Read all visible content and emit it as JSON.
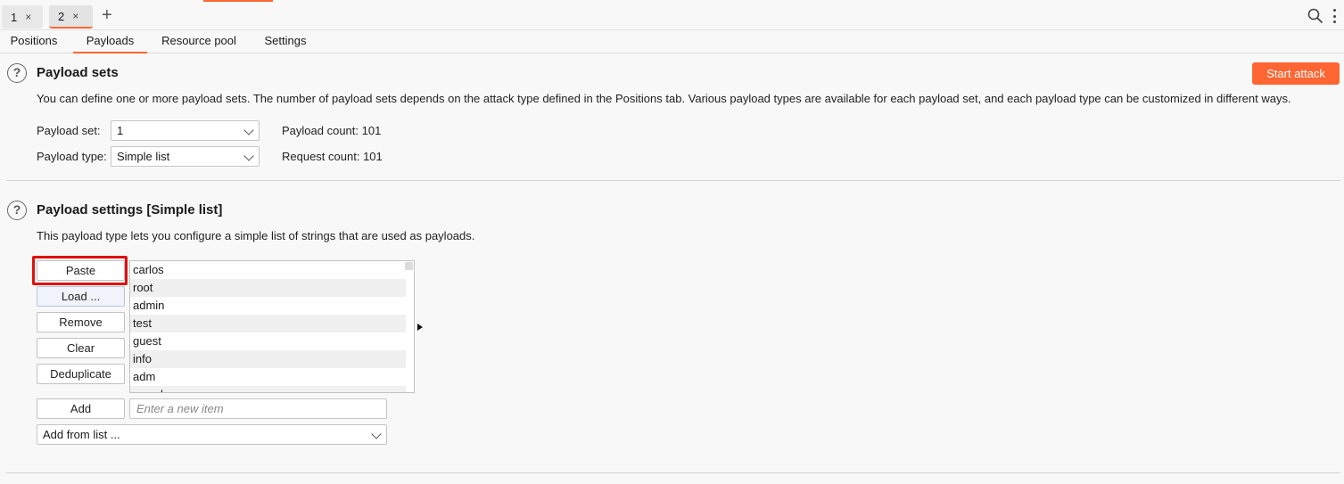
{
  "top_tabs": [
    {
      "label": "1",
      "close": "×"
    },
    {
      "label": "2",
      "close": "×"
    }
  ],
  "new_tab_glyph": "+",
  "icons": {
    "search": "search-icon",
    "more": "kebab-menu-icon",
    "help": "help-circle-icon"
  },
  "sub_tabs": [
    "Positions",
    "Payloads",
    "Resource pool",
    "Settings"
  ],
  "active_sub_tab": "Payloads",
  "colors": {
    "accent": "#ff6633",
    "highlight": "#e01010"
  },
  "payload_sets": {
    "help_glyph": "?",
    "title": "Payload sets",
    "description": "You can define one or more payload sets. The number of payload sets depends on the attack type defined in the Positions tab. Various payload types are available for each payload set, and each payload type can be customized in different ways.",
    "start_attack": "Start attack",
    "payload_set_label": "Payload set:",
    "payload_set_value": "1",
    "payload_type_label": "Payload type:",
    "payload_type_value": "Simple list",
    "payload_count_label": "Payload count:",
    "payload_count_value": "101",
    "request_count_label": "Request count:",
    "request_count_value": "101"
  },
  "payload_settings": {
    "help_glyph": "?",
    "title": "Payload settings [Simple list]",
    "description": "This payload type lets you configure a simple list of strings that are used as payloads.",
    "buttons": {
      "paste": "Paste",
      "load": "Load ...",
      "remove": "Remove",
      "clear": "Clear",
      "deduplicate": "Deduplicate",
      "add": "Add"
    },
    "items": [
      "carlos",
      "root",
      "admin",
      "test",
      "guest",
      "info",
      "adm",
      "mysql"
    ],
    "new_item_placeholder": "Enter a new item",
    "add_from_list": "Add from list ..."
  }
}
